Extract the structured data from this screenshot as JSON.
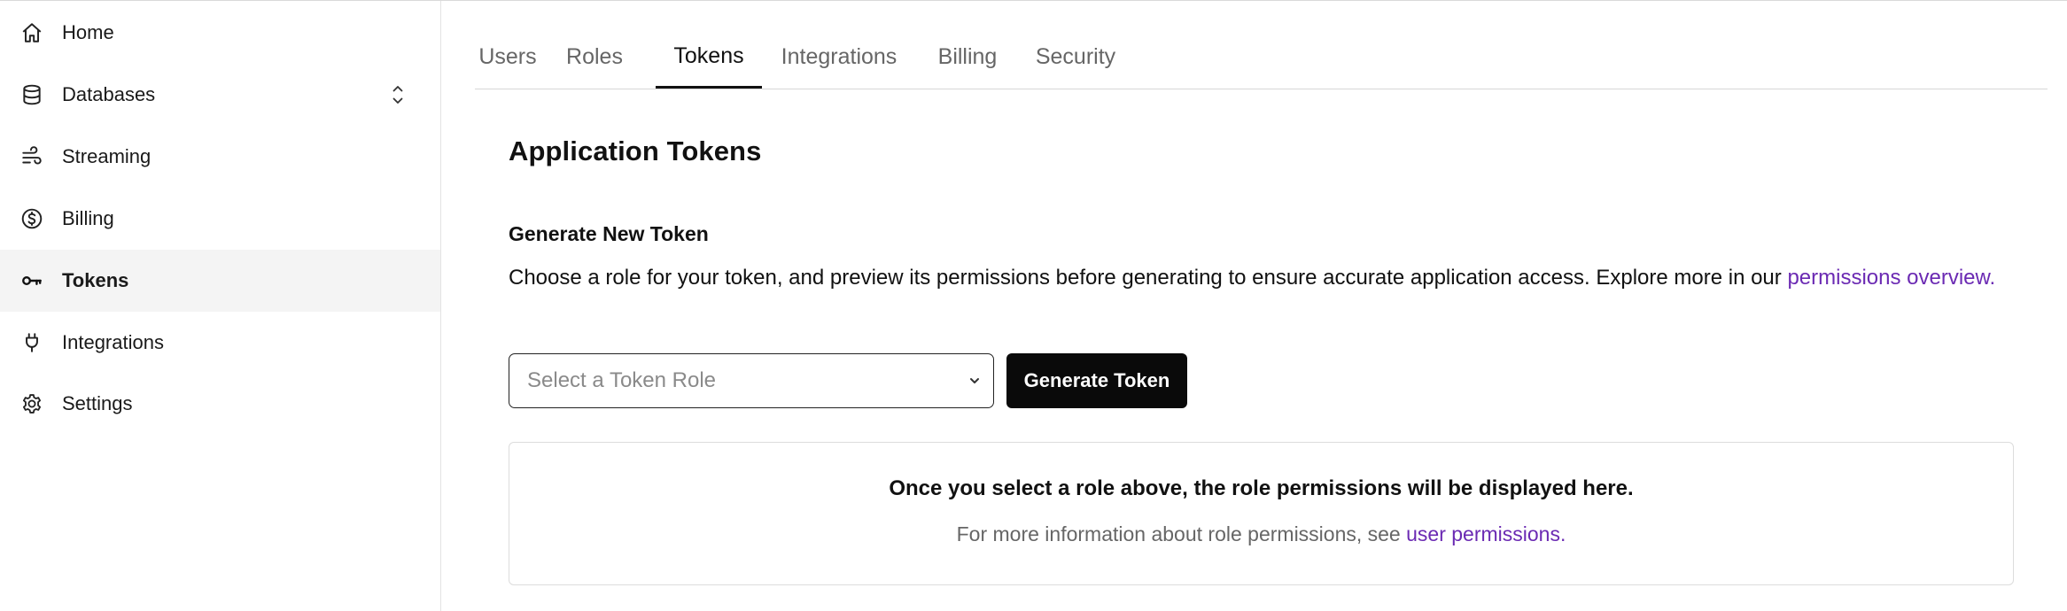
{
  "sidebar": {
    "items": [
      {
        "label": "Home",
        "icon": "home-icon",
        "active": false
      },
      {
        "label": "Databases",
        "icon": "database-icon",
        "active": false,
        "expandable": true
      },
      {
        "label": "Streaming",
        "icon": "streaming-icon",
        "active": false
      },
      {
        "label": "Billing",
        "icon": "dollar-circle-icon",
        "active": false
      },
      {
        "label": "Tokens",
        "icon": "key-icon",
        "active": true
      },
      {
        "label": "Integrations",
        "icon": "plug-icon",
        "active": false
      },
      {
        "label": "Settings",
        "icon": "gear-icon",
        "active": false
      }
    ]
  },
  "tabs": [
    {
      "label": "Users",
      "active": false
    },
    {
      "label": "Roles",
      "active": false
    },
    {
      "label": "Tokens",
      "active": true
    },
    {
      "label": "Integrations",
      "active": false
    },
    {
      "label": "Billing",
      "active": false
    },
    {
      "label": "Security",
      "active": false
    }
  ],
  "content": {
    "title": "Application Tokens",
    "generate_heading": "Generate New Token",
    "description": "Choose a role for your token, and preview its permissions before generating to ensure accurate application access. Explore more in our ",
    "description_link": "permissions overview",
    "description_end": ".",
    "select_placeholder": "Select a Token Role",
    "generate_button": "Generate Token",
    "info_title": "Once you select a role above, the role permissions will be displayed here.",
    "info_text": "For more information about role permissions, see ",
    "info_link": "user permissions",
    "info_end": "."
  },
  "colors": {
    "link": "#6b2ab3",
    "button_bg": "#0a0a0a",
    "active_nav_bg": "#f4f4f4"
  }
}
